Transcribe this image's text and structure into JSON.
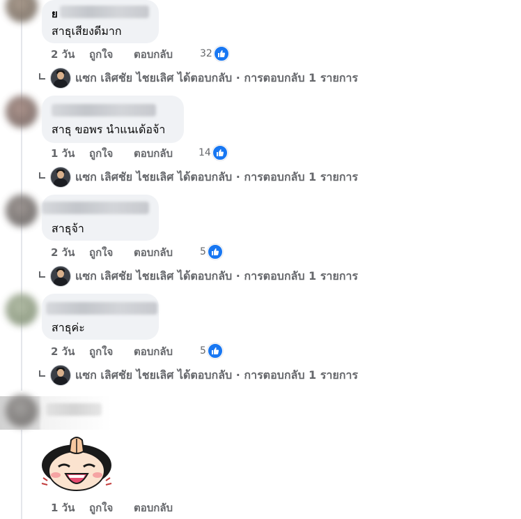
{
  "comments": [
    {
      "author_visible": "ย",
      "text": "สาธุเสียงดีมาก",
      "age": "2 วัน",
      "like_label": "ถูกใจ",
      "reply_label": "ตอบกลับ",
      "reaction_count": "32",
      "reply_summary": "แซก เลิศชัย ไชยเลิศ ได้ตอบกลับ · การตอบกลับ 1 รายการ"
    },
    {
      "text": "สาธุ ขอพร นำแนเด้อจ้า",
      "age": "1 วัน",
      "like_label": "ถูกใจ",
      "reply_label": "ตอบกลับ",
      "reaction_count": "14",
      "reply_summary": "แซก เลิศชัย ไชยเลิศ ได้ตอบกลับ · การตอบกลับ 1 รายการ"
    },
    {
      "text": "สาธุจ้า",
      "age": "2 วัน",
      "like_label": "ถูกใจ",
      "reply_label": "ตอบกลับ",
      "reaction_count": "5",
      "reply_summary": "แซก เลิศชัย ไชยเลิศ ได้ตอบกลับ · การตอบกลับ 1 รายการ"
    },
    {
      "text": "สาธุค่ะ",
      "age": "2 วัน",
      "like_label": "ถูกใจ",
      "reply_label": "ตอบกลับ",
      "reaction_count": "5",
      "reply_summary": "แซก เลิศชัย ไชยเลิศ ได้ตอบกลับ · การตอบกลับ 1 รายการ"
    },
    {
      "sticker": "praying-kid-sticker",
      "age": "1 วัน",
      "like_label": "ถูกใจ",
      "reply_label": "ตอบกลับ"
    }
  ],
  "colors": {
    "bubble": "#f0f2f5",
    "meta_text": "#65676b",
    "like_blue": "#1877f2"
  },
  "icons": {
    "reaction": "thumbs-up-icon",
    "reply_arrow": "reply-arrow-icon"
  }
}
